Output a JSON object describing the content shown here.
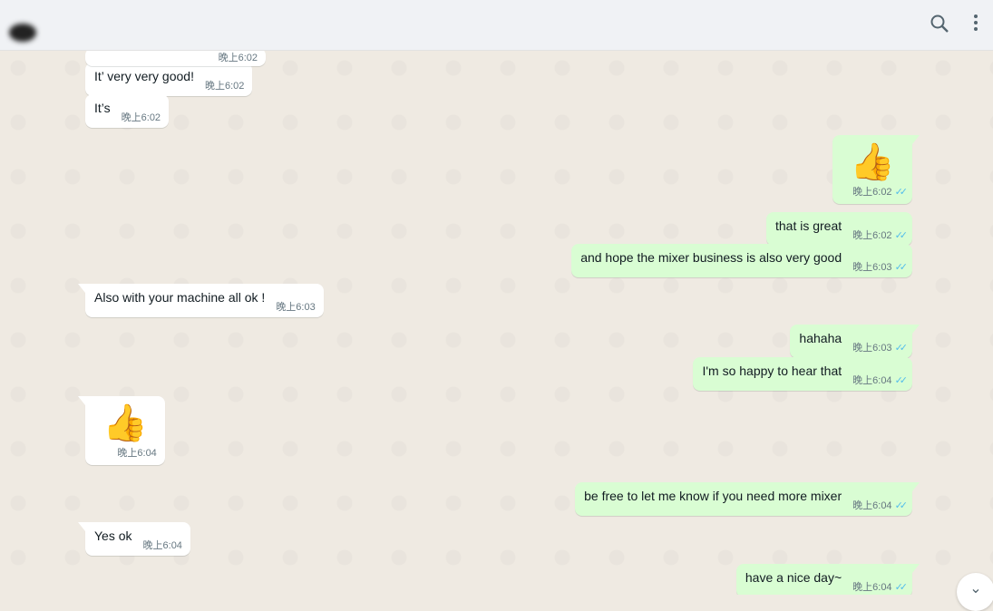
{
  "header": {
    "search_icon": "search-icon",
    "menu_icon": "kebab-menu-icon"
  },
  "messages": [
    {
      "dir": "in",
      "text": "",
      "time": "晚上6:02"
    },
    {
      "dir": "in",
      "text": "It’ very very good!",
      "time": "晚上6:02"
    },
    {
      "dir": "in",
      "text": "It’s",
      "time": "晚上6:02"
    },
    {
      "dir": "out",
      "text": "👍",
      "time": "晚上6:02",
      "ticks": "✓✓"
    },
    {
      "dir": "out",
      "text": "that is great",
      "time": "晚上6:02",
      "ticks": "✓✓"
    },
    {
      "dir": "out",
      "text": "and hope the mixer business is also very good",
      "time": "晚上6:03",
      "ticks": "✓✓"
    },
    {
      "dir": "in",
      "text": "Also with your machine all ok !",
      "time": "晚上6:03"
    },
    {
      "dir": "out",
      "text": "hahaha",
      "time": "晚上6:03",
      "ticks": "✓✓"
    },
    {
      "dir": "out",
      "text": "I'm so happy to hear that",
      "time": "晚上6:04",
      "ticks": "✓✓"
    },
    {
      "dir": "in",
      "text": "👍",
      "time": "晚上6:04"
    },
    {
      "dir": "out",
      "text": "be free to let me know if you need more mixer",
      "time": "晚上6:04",
      "ticks": "✓✓"
    },
    {
      "dir": "in",
      "text": "Yes ok",
      "time": "晚上6:04"
    },
    {
      "dir": "out",
      "text": "have a nice day~",
      "time": "晚上6:04",
      "ticks": "✓✓"
    }
  ],
  "scroll_down": "⌄"
}
